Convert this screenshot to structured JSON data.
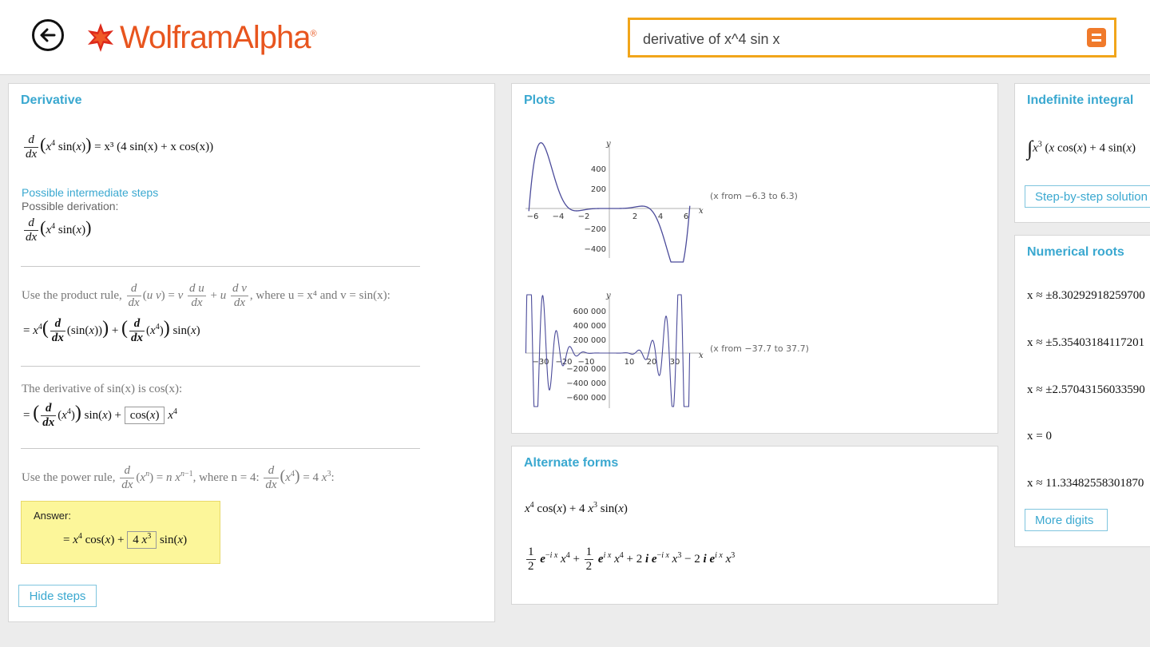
{
  "header": {
    "logo_text": "WolframAlpha",
    "logo_reg": "®",
    "search_value": "derivative of x^4 sin x"
  },
  "colors": {
    "accent": "#3aa8d0",
    "brand": "#e8551e",
    "search_border": "#f1a51a",
    "answer_bg": "#fcf69a",
    "curve": "#4b4b9a"
  },
  "derivative": {
    "title": "Derivative",
    "result_rhs": "= x³ (4 sin(x) + x cos(x))",
    "intermediate_link": "Possible intermediate steps",
    "possible_derivation": "Possible derivation:",
    "step1_text": "Use the product rule,",
    "step1_where": ", where u = x⁴ and v = sin(x):",
    "step2_text": "The derivative of sin(x) is cos(x):",
    "step3_text": "Use the power rule,",
    "step3_where": ", where n = 4:",
    "answer_label": "Answer:",
    "hide_steps": "Hide steps"
  },
  "plots": {
    "title": "Plots",
    "plot1": {
      "range_note": "(x from −6.3 to 6.3)",
      "y_label": "y",
      "x_label": "x",
      "y_ticks": [
        "400",
        "200",
        "−200",
        "−400"
      ],
      "x_ticks": [
        "−6",
        "−4",
        "−2",
        "2",
        "4",
        "6"
      ]
    },
    "plot2": {
      "range_note": "(x from −37.7 to 37.7)",
      "y_label": "y",
      "x_label": "x",
      "y_ticks": [
        "600 000",
        "400 000",
        "200 000",
        "−200 000",
        "−400 000",
        "−600 000"
      ],
      "x_ticks": [
        "−30",
        "−20",
        "−10",
        "10",
        "20",
        "30"
      ]
    }
  },
  "alternate_forms": {
    "title": "Alternate forms"
  },
  "indefinite_integral": {
    "title": "Indefinite integral",
    "step_button": "Step-by-step solution"
  },
  "numerical_roots": {
    "title": "Numerical roots",
    "roots": [
      "x ≈ ±8.30292918259700",
      "x ≈ ±5.35403184117201",
      "x ≈ ±2.57043156033590",
      "x = 0",
      "x ≈ 11.33482558301870"
    ],
    "more_digits": "More digits"
  }
}
